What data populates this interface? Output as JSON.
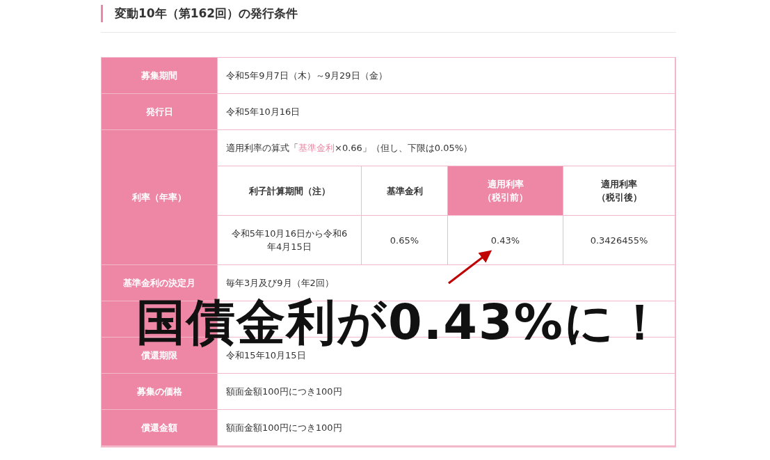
{
  "title": "変動10年（第162回）の発行条件",
  "table": {
    "rows": [
      {
        "kind": "text",
        "label": "募集期間",
        "value": "令和5年9月7日（木）～9月29日（金）"
      },
      {
        "kind": "text",
        "label": "発行日",
        "value": "令和5年10月16日"
      },
      {
        "kind": "rate",
        "label": "利率（年率）",
        "formula": {
          "before": "適用利率の算式「",
          "link": "基準金利",
          "after": "×0.66」（但し、下限は0.05%）"
        },
        "columns": [
          {
            "lines": [
              "利子計算期間（注）"
            ],
            "highlighted": false
          },
          {
            "lines": [
              "基準金利"
            ],
            "highlighted": false
          },
          {
            "lines": [
              "適用利率",
              "（税引前）"
            ],
            "highlighted": true
          },
          {
            "lines": [
              "適用利率",
              "（税引後）"
            ],
            "highlighted": false
          }
        ],
        "cells": [
          "令和5年10月16日から令和6年4月15日",
          "0.65%",
          "0.43%",
          "0.3426455%"
        ]
      },
      {
        "kind": "text",
        "label": "基準金利の決定月",
        "value": "毎年3月及び9月（年2回）"
      },
      {
        "kind": "covered"
      },
      {
        "kind": "text",
        "label": "償還期限",
        "value": "令和15年10月15日"
      },
      {
        "kind": "text",
        "label": "募集の価格",
        "value": "額面金額100円につき100円"
      },
      {
        "kind": "text",
        "label": "償還金額",
        "value": "額面金額100円につき100円"
      }
    ]
  },
  "callout": "国債金利が0.43%に！"
}
